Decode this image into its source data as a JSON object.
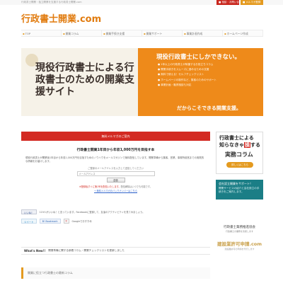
{
  "topbar": {
    "tagline": "行政書士開業・独立開業を支援する行政書士開業.com",
    "button_contact": "■ 相談・お問い合わせ",
    "button_register": "■ メルマガ登録"
  },
  "header": {
    "logo": "行政書士開業.com"
  },
  "nav": {
    "items": [
      "TOP",
      "開業コラム",
      "開業手続き支援",
      "開業サポート",
      "事業計画作成",
      "ホームページ作成"
    ]
  },
  "hero": {
    "headline": "現役行政書士による行政書士のための開業支援サイト",
    "right_title": "現役行政書士にしかできない。",
    "points": [
      "1年以上の行政書士が執筆するお役立ちコラム",
      "開業手続きをスムーズに進めるための支援",
      "無料で使える！セルフチェックリスト",
      "ホームページの制作など、集客のためのサポート",
      "事業計画・融資相談も対応"
    ],
    "footer": "だからこそできる開業支援。"
  },
  "main": {
    "banner": "無料メルマガのご案内",
    "title": "行政書士開業1年目から年収1,000万円を目指す本",
    "paragraph": "現役行政書士が開業後1年目から年収1,000万円を目指すためのノウハウをメールマガジンで無料配信しています。開業準備から集客、営業、事務所経営までの実践的な情報をお届けします。",
    "subscribe_label": "ご登録のメールアドレスを入力して送信してください",
    "subscribe_placeholder": "メールアドレス",
    "subscribe_button": "送信",
    "note_red": "※登録後すぐに第1号を配信いたします。",
    "note_plain": "配信解除はいつでも可能です。",
    "link_text": "→ 無料メルマガのバックナンバーはこちら"
  },
  "social": {
    "like": "いいね！",
    "like_text": "119人がいいね！と言っています。Facebookに登録して、友達のアクティビティを見てみましょう。",
    "tweet": "ツイート",
    "hatena": "B! Bookmark",
    "g_label": "g",
    "g_text": "Googleでおすすめ"
  },
  "news": {
    "label": "What's New!!",
    "text": "開業準備に関する新着コラム・開業チェックリストを更新しました"
  },
  "section_head": "開業に役立つ行政書士の最新コラム",
  "sidebar": {
    "ad_line1": "行政書士による",
    "ad_line2_pre": "知らなきゃ",
    "ad_line2_hl": "損",
    "ad_line2_post": "する",
    "ad_line3": "実務コラム",
    "ad_pill": "詳しくはこちら",
    "teal_title": "会社設立開業をサポート！",
    "teal_text": "開業サービスの紹介と会社設立の手続きをご案内します。",
    "assoc": "行政書士業務推進協会",
    "assoc_sub": "行政書士の業務を支援します",
    "shinsei": "建設業許可申請.com",
    "shinsei_sub": "建設業許可の申請を代行します"
  }
}
